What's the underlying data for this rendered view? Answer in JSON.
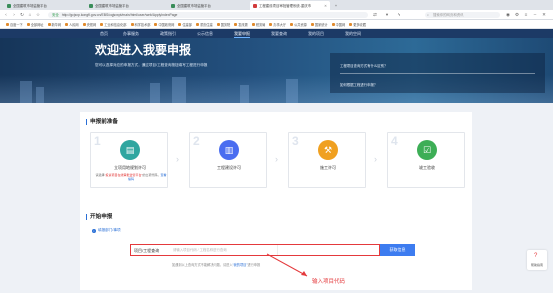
{
  "browser": {
    "tabs": [
      {
        "label": "全国建筑市场监管平台"
      },
      {
        "label": "全国建筑市场监管平台"
      },
      {
        "label": "全国建筑市场监管平台"
      },
      {
        "label": "工程建设项目审批管理系统-重庆市"
      }
    ],
    "new_tab": "+",
    "url_secure_label": "安全",
    "url": "http://gcjsxp.kongfl.gov.cn/EBS/cqjsxxpt/main/html/user/web/ApplyIndexPage",
    "search_placeholder": "搜索你的网页和资讯",
    "bookmarks": [
      "百度一下",
      "全部网址",
      "新华网",
      "人民网",
      "央视网",
      "工业和信息化部",
      "科学技术部",
      "中国政府网",
      "住建部",
      "重庆住建",
      "国务院",
      "发改委",
      "税务局",
      "办事大厅",
      "公共资源",
      "国家统计",
      "中国网",
      "更多收藏"
    ]
  },
  "site_nav": {
    "items": [
      "首页",
      "办事服务",
      "政策指引",
      "公示信息",
      "我要申报",
      "我要查询",
      "我的项目",
      "我的空间"
    ],
    "active_index": 4
  },
  "banner": {
    "title": "欢迎进入我要申报",
    "subtitle": "您可以选择对应的申报方式，通过项目/工程查询按钮填写工程进行申报",
    "links": [
      "工程项目查询方式有什么区别？",
      "如何根据工程进行申报？"
    ]
  },
  "prep": {
    "title": "申报前准备",
    "steps": [
      {
        "num": "1",
        "label": "立项用地规划许可",
        "icon": "document-icon",
        "color": "#2fa6a0"
      },
      {
        "num": "2",
        "label": "工程建设许可",
        "icon": "building-icon",
        "color": "#4a6df0"
      },
      {
        "num": "3",
        "label": "施工许可",
        "icon": "worker-icon",
        "color": "#f0a020"
      },
      {
        "num": "4",
        "label": "竣工验收",
        "icon": "checklist-icon",
        "color": "#3dae56"
      }
    ],
    "step1_note_prefix": "请选择",
    "step1_note_highlight": "“投资项目在线审批监管平台”",
    "step1_note_mid": "的立项代码，",
    "step1_note_link": "查看编码"
  },
  "start": {
    "title": "开始申报",
    "guide_label": "填报部门/事项",
    "input_label": "项目/工程查询",
    "input_placeholder": "请输入项目代码 / 工程名称进行查询",
    "go_button": "获取信息",
    "hint_prefix": "如遇到以上查询方式不能解决问题，请进入",
    "hint_link": "“我的项目”",
    "hint_suffix": "进行申报"
  },
  "annotation": {
    "text": "输入项目代码",
    "color": "#e4393c"
  },
  "floating": {
    "label": "帮助指南"
  }
}
